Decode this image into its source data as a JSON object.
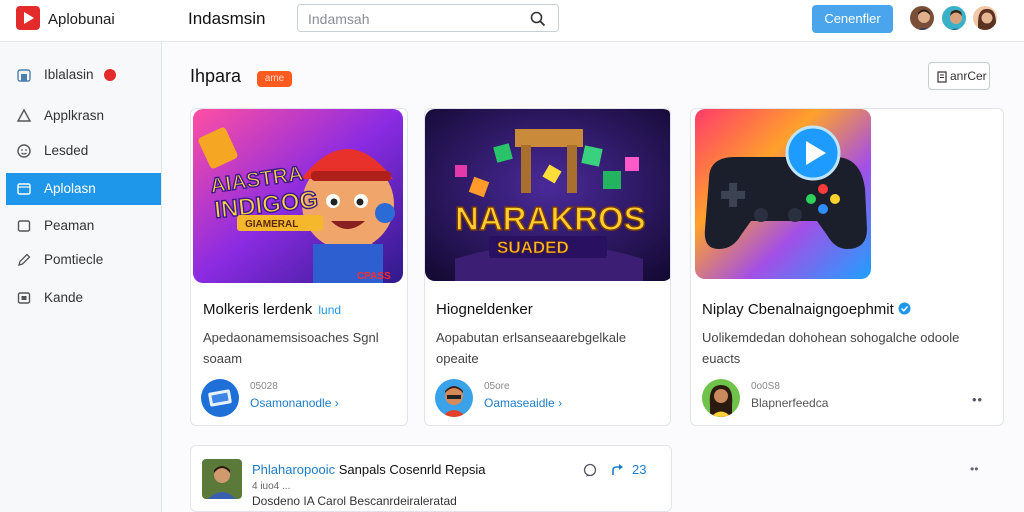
{
  "app": {
    "name": "Aplobunai"
  },
  "header": {
    "title": "Indasmsin",
    "search_placeholder": "Indamsah",
    "connect_label": "Cenenfler"
  },
  "sidebar": {
    "items": [
      {
        "label": "Iblalasin",
        "icon": "home-icon"
      },
      {
        "label": "Applkrasn",
        "icon": "triangle-icon"
      },
      {
        "label": "Lesded",
        "icon": "smiley-icon"
      },
      {
        "label": "Aplolasn",
        "icon": "folder-icon",
        "active": true
      },
      {
        "label": "Peaman",
        "icon": "square-icon"
      },
      {
        "label": "Pomtiecle",
        "icon": "pencil-icon"
      },
      {
        "label": "Kande",
        "icon": "box-icon"
      }
    ]
  },
  "main": {
    "section_title": "Ihpara",
    "section_tag": "ame",
    "action_button": "anrCer"
  },
  "cards": [
    {
      "art_text_top": "AIASTRA",
      "art_text_mid": "INDIGOG",
      "art_text_low": "GIAMERAL",
      "art_corner": "CPASS",
      "title": "Molkeris lerdenk",
      "title_chip": "lund",
      "desc_line1": "Apedaonamemsisoaches Sgnl",
      "desc_line2": "soaam",
      "author_meta": "05028",
      "author_name": "Osamonanodle"
    },
    {
      "art_text_top": "NARAKROS",
      "art_text_low": "SUADED",
      "title": "Hiogneldenker",
      "desc_line1": "Aopabutan erlsanseaarebgelkale",
      "desc_line2": "opeaite",
      "author_meta": "05ore",
      "author_name": "Oamaseaidle"
    },
    {
      "title": "Niplay Cbenalnaigngoephmit",
      "desc_line1": "Uolikemdedan dohohean sohogalche odoole",
      "desc_line2": "euacts",
      "author_meta": "0o0S8",
      "author_name": "Blapnerfeedca"
    }
  ],
  "feed": {
    "title_link": "Phlaharopooic",
    "title_rest": "Sanpals Cosenrld Repsia",
    "meta": "4 iuo4 ...",
    "subtitle": "Dosdeno IA Carol Bescanrdeiraleratad",
    "count": "23"
  },
  "colors": {
    "accent": "#1e97ea",
    "brand": "#e32b2b",
    "tag": "#ff5a1f",
    "connect": "#4aa5ec"
  }
}
